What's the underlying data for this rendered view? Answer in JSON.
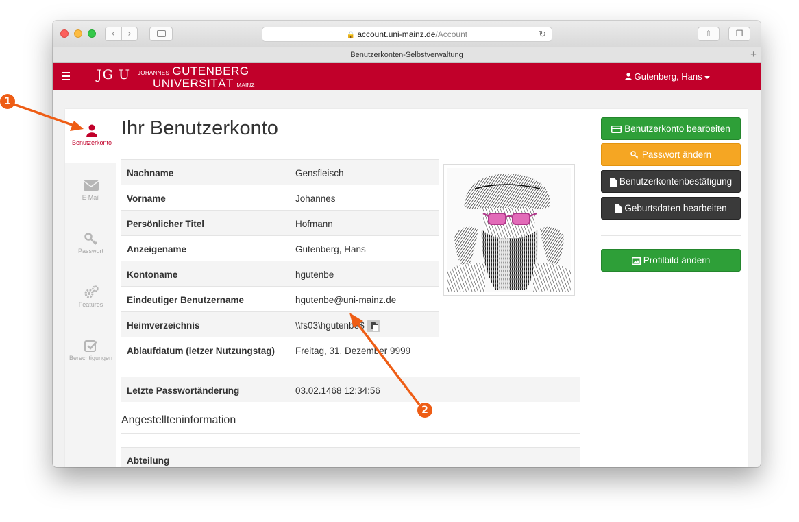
{
  "browser": {
    "url_domain": "account.uni-mainz.de",
    "url_path": "/Account",
    "tab_title": "Benutzerkonten-Selbstverwaltung"
  },
  "header": {
    "logo_jg": "JG",
    "logo_u": "U",
    "logo_line1_small": "JOHANNES",
    "logo_line1_big": "GUTENBERG",
    "logo_line2_big": "UNIVERSITÄT",
    "logo_line2_small": "MAINZ",
    "user_name": "Gutenberg, Hans"
  },
  "sidenav": {
    "items": [
      {
        "label": "Benutzerkonto",
        "icon": "user-icon",
        "active": true
      },
      {
        "label": "E-Mail",
        "icon": "envelope-icon",
        "active": false
      },
      {
        "label": "Passwort",
        "icon": "key-icon",
        "active": false
      },
      {
        "label": "Features",
        "icon": "gears-icon",
        "active": false
      },
      {
        "label": "Berechtigungen",
        "icon": "checkbox-icon",
        "active": false
      }
    ]
  },
  "main": {
    "title": "Ihr Benutzerkonto",
    "rows": [
      {
        "label": "Nachname",
        "value": "Gensfleisch"
      },
      {
        "label": "Vorname",
        "value": "Johannes"
      },
      {
        "label": "Persönlicher Titel",
        "value": "Hofmann"
      },
      {
        "label": "Anzeigename",
        "value": "Gutenberg, Hans"
      },
      {
        "label": "Kontoname",
        "value": "hgutenbe"
      },
      {
        "label": "Eindeutiger Benutzername",
        "value": "hgutenbe@uni-mainz.de"
      },
      {
        "label": "Heimverzeichnis",
        "value": "\\\\fs03\\hgutenbe$"
      },
      {
        "label": "Ablaufdatum (letzer Nutzungstag)",
        "value": "Freitag, 31. Dezember 9999"
      },
      {
        "label": "Letzte Passwortänderung",
        "value": "03.02.1468 12:34:56"
      }
    ],
    "section_title": "Angestellteninformation",
    "dept_label": "Abteilung"
  },
  "actions": {
    "edit_account": "Benutzerkonto bearbeiten",
    "change_password": "Passwort ändern",
    "account_confirmation": "Benutzerkontenbestätigung",
    "edit_birth_data": "Geburtsdaten bearbeiten",
    "change_profile_picture": "Profilbild ändern"
  },
  "annotations": {
    "one": "1",
    "two": "2",
    "color": "#ee5d15"
  },
  "colors": {
    "brand_red": "#c1002a",
    "green": "#2e9f38",
    "orange": "#f5a623",
    "dark": "#3a3a3a"
  }
}
